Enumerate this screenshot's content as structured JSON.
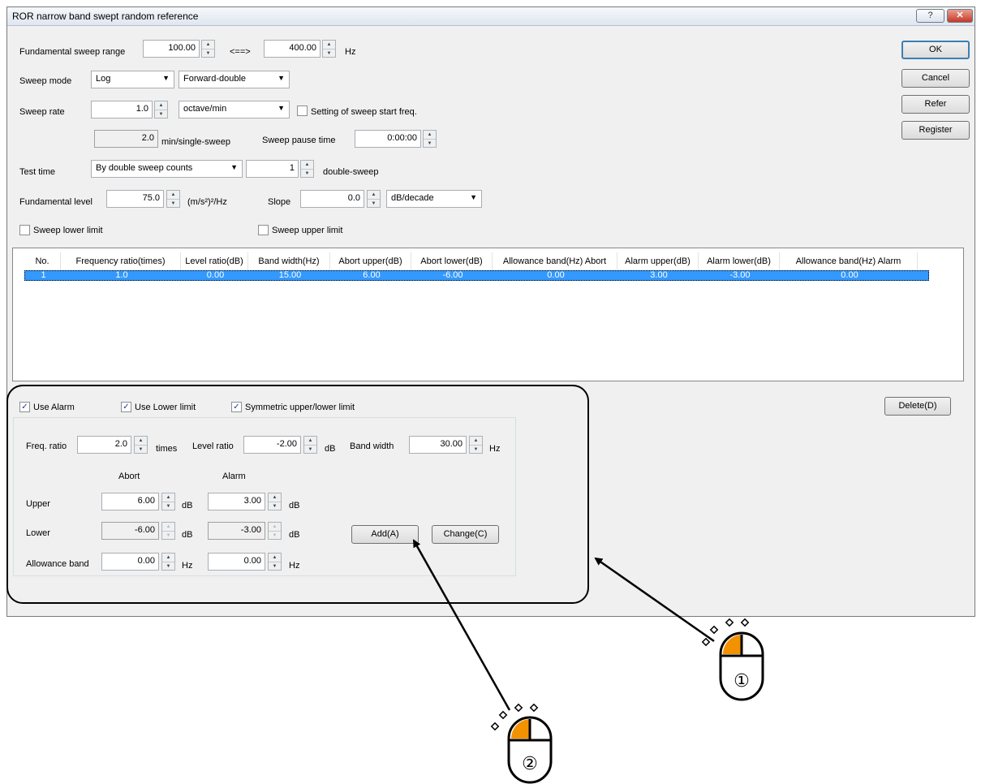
{
  "window": {
    "title": "ROR narrow band swept random reference",
    "help_label": "?",
    "close_label": "✕"
  },
  "fund_sweep": {
    "label": "Fundamental sweep range",
    "from": "100.00",
    "sep": "<==>",
    "to": "400.00",
    "unit": "Hz"
  },
  "sweep_mode": {
    "label": "Sweep mode",
    "mode": "Log",
    "direction": "Forward-double"
  },
  "sweep_rate": {
    "label": "Sweep rate",
    "value": "1.0",
    "unit": "octave/min",
    "start_freq_label": "Setting of sweep start freq."
  },
  "single_sweep": {
    "value": "2.0",
    "unit": "min/single-sweep",
    "pause_label": "Sweep pause time",
    "pause_value": "0:00:00"
  },
  "test_time": {
    "label": "Test time",
    "mode": "By double sweep counts",
    "count": "1",
    "unit": "double-sweep"
  },
  "fund_level": {
    "label": "Fundamental level",
    "value": "75.0",
    "unit": "(m/s²)²/Hz",
    "slope_label": "Slope",
    "slope_value": "0.0",
    "slope_unit": "dB/decade"
  },
  "limits": {
    "lower_label": "Sweep lower limit",
    "upper_label": "Sweep upper limit"
  },
  "buttons": {
    "ok": "OK",
    "cancel": "Cancel",
    "refer": "Refer",
    "register": "Register",
    "delete": "Delete(D)",
    "add": "Add(A)",
    "change": "Change(C)"
  },
  "table": {
    "columns": [
      "No.",
      "Frequency ratio(times)",
      "Level ratio(dB)",
      "Band width(Hz)",
      "Abort upper(dB)",
      "Abort lower(dB)",
      "Allowance band(Hz) Abort",
      "Alarm upper(dB)",
      "Alarm lower(dB)",
      "Allowance band(Hz) Alarm"
    ],
    "rows": [
      [
        "1",
        "1.0",
        "0.00",
        "15.00",
        "6.00",
        "-6.00",
        "0.00",
        "3.00",
        "-3.00",
        "0.00"
      ]
    ]
  },
  "options": {
    "use_alarm": "Use Alarm",
    "use_lower": "Use Lower limit",
    "symmetric": "Symmetric upper/lower limit"
  },
  "editor": {
    "freq_ratio_label": "Freq. ratio",
    "freq_ratio": "2.0",
    "freq_unit": "times",
    "level_ratio_label": "Level ratio",
    "level_ratio": "-2.00",
    "level_unit": "dB",
    "band_width_label": "Band width",
    "band_width": "30.00",
    "band_unit": "Hz",
    "abort_header": "Abort",
    "alarm_header": "Alarm",
    "upper_label": "Upper",
    "abort_upper": "6.00",
    "alarm_upper": "3.00",
    "lower_label": "Lower",
    "abort_lower": "-6.00",
    "alarm_lower": "-3.00",
    "allow_label": "Allowance band",
    "abort_allow": "0.00",
    "alarm_allow": "0.00",
    "db": "dB",
    "hz": "Hz"
  },
  "callouts": {
    "one": "①",
    "two": "②"
  },
  "colors": {
    "selection": "#3399ff",
    "mouse_button": "#f39200"
  }
}
